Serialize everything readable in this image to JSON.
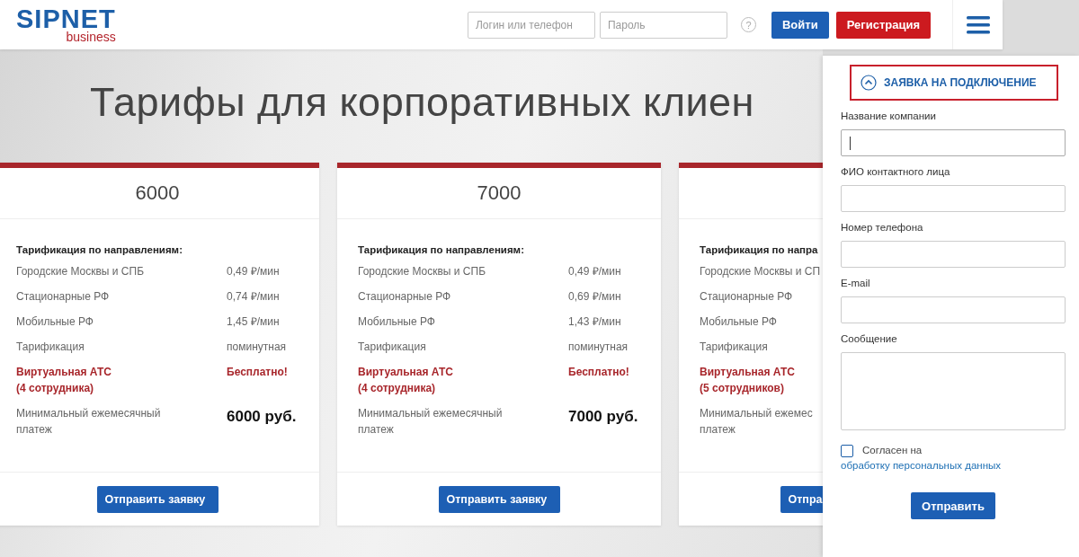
{
  "header": {
    "logo": {
      "name": "SIPNET",
      "sub": "business"
    },
    "login": {
      "placeholder": "Логин или телефон"
    },
    "password": {
      "placeholder": "Пароль"
    },
    "help": "?",
    "buttons": [
      {
        "label": "Войти",
        "kind": "primary"
      },
      {
        "label": "Регистрация",
        "kind": "danger"
      }
    ]
  },
  "title": "Тарифы для корпоративных клиен",
  "cards": [
    {
      "title": "6000",
      "heading": "Тарификация по направлениям:",
      "rows": [
        {
          "label": "Городские Москвы и СПБ",
          "value": "0,49 ₽/мин"
        },
        {
          "label": "Стационарные РФ",
          "value": "0,74 ₽/мин"
        },
        {
          "label": "Мобильные РФ",
          "value": "1,45 ₽/мин"
        },
        {
          "label": "Тарификация",
          "value": "поминутная"
        }
      ],
      "pbx": {
        "label": "Виртуальная АТС\n(4 сотрудника)",
        "value": "Бесплатно!"
      },
      "minimum": {
        "label": "Минимальный ежемесячный\nплатеж",
        "value": "6000 руб."
      },
      "button": "Отправить заявку"
    },
    {
      "title": "7000",
      "heading": "Тарификация по направлениям:",
      "rows": [
        {
          "label": "Городские Москвы и СПБ",
          "value": "0,49 ₽/мин"
        },
        {
          "label": "Стационарные РФ",
          "value": "0,69 ₽/мин"
        },
        {
          "label": "Мобильные РФ",
          "value": "1,43 ₽/мин"
        },
        {
          "label": "Тарификация",
          "value": "поминутная"
        }
      ],
      "pbx": {
        "label": "Виртуальная АТС\n(4 сотрудника)",
        "value": "Бесплатно!"
      },
      "minimum": {
        "label": "Минимальный ежемесячный\nплатеж",
        "value": "7000 руб."
      },
      "button": "Отправить заявку"
    },
    {
      "heading": "Тарификация по напра",
      "rows": [
        {
          "label": "Городские Москвы и СП"
        },
        {
          "label": "Стационарные РФ"
        },
        {
          "label": "Мобильные РФ"
        },
        {
          "label": "Тарификация"
        }
      ],
      "pbx": {
        "label": "Виртуальная АТС\n(5 сотрудников)"
      },
      "minimum": {
        "label": "Минимальный ежемес\nплатеж"
      },
      "button": "Отпра"
    }
  ],
  "request_panel": {
    "title": "ЗАЯВКА НА ПОДКЛЮЧЕНИЕ",
    "expanded": true,
    "fields": [
      {
        "label": "Название компании",
        "kind": "input",
        "focused": true
      },
      {
        "label": "ФИО контактного лица",
        "kind": "input",
        "focused": false
      },
      {
        "label": "Номер телефона",
        "kind": "input",
        "focused": false
      },
      {
        "label": "E-mail",
        "kind": "input",
        "focused": false
      },
      {
        "label": "Сообщение",
        "kind": "textarea",
        "focused": false
      }
    ],
    "consent": {
      "text": "Согласен на ",
      "link": "обработку персональных данных",
      "checked": false
    },
    "submit": "Отправить"
  }
}
